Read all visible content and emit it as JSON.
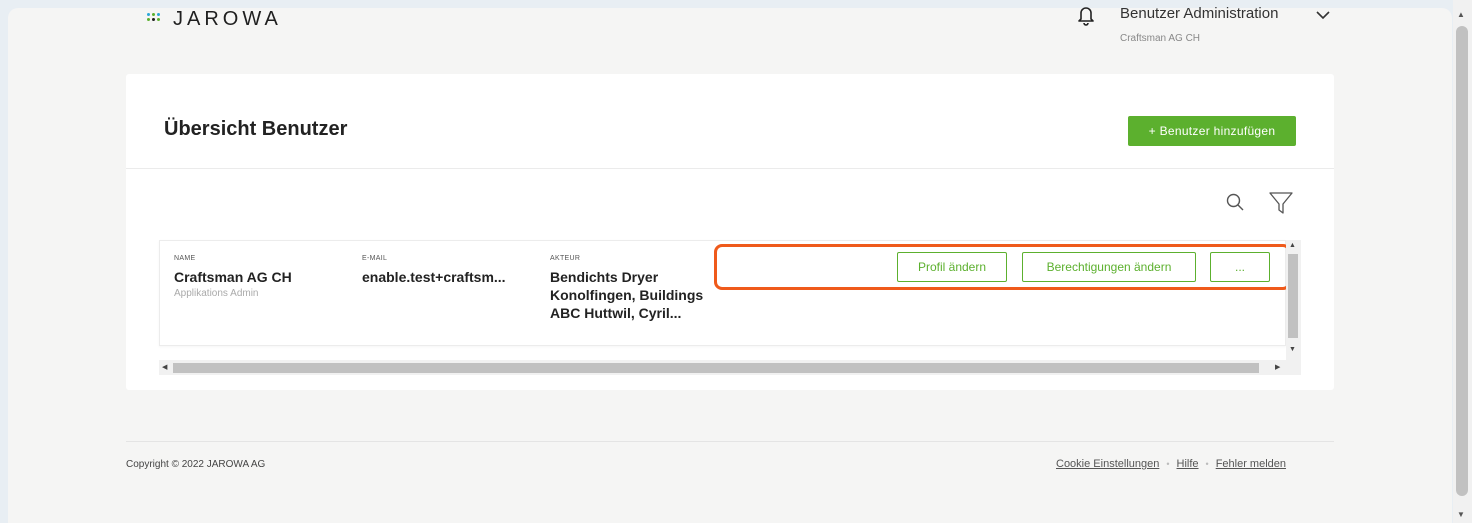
{
  "header": {
    "logo_text": "JAROWA",
    "user_title": "Benutzer Administration",
    "user_sub": "Craftsman AG CH"
  },
  "card": {
    "title": "Übersicht Benutzer",
    "add_button": "+ Benutzer hinzufügen"
  },
  "table": {
    "columns": {
      "name": "NAME",
      "email": "E-MAIL",
      "actor": "AKTEUR"
    },
    "rows": [
      {
        "name": "Craftsman AG CH",
        "role": "Applikations Admin",
        "email": "enable.test+craftsm...",
        "actor_line1": "Bendichts Dryer",
        "actor_line2": "Konolfingen, Buildings",
        "actor_line3": "ABC Huttwil, Cyril..."
      }
    ],
    "actions": {
      "profile": "Profil ändern",
      "permissions": "Berechtigungen ändern",
      "more": "..."
    }
  },
  "footer": {
    "copyright": "Copyright © 2022 JAROWA AG",
    "links": [
      "Cookie Einstellungen",
      "Hilfe",
      "Fehler melden"
    ]
  },
  "colors": {
    "accent": "#5cb02e",
    "highlight": "#ef5a1b",
    "background": "#f5f5f4"
  },
  "icons": [
    "logo-dots-icon",
    "bell-icon",
    "chevron-down-icon",
    "search-icon",
    "filter-icon"
  ]
}
